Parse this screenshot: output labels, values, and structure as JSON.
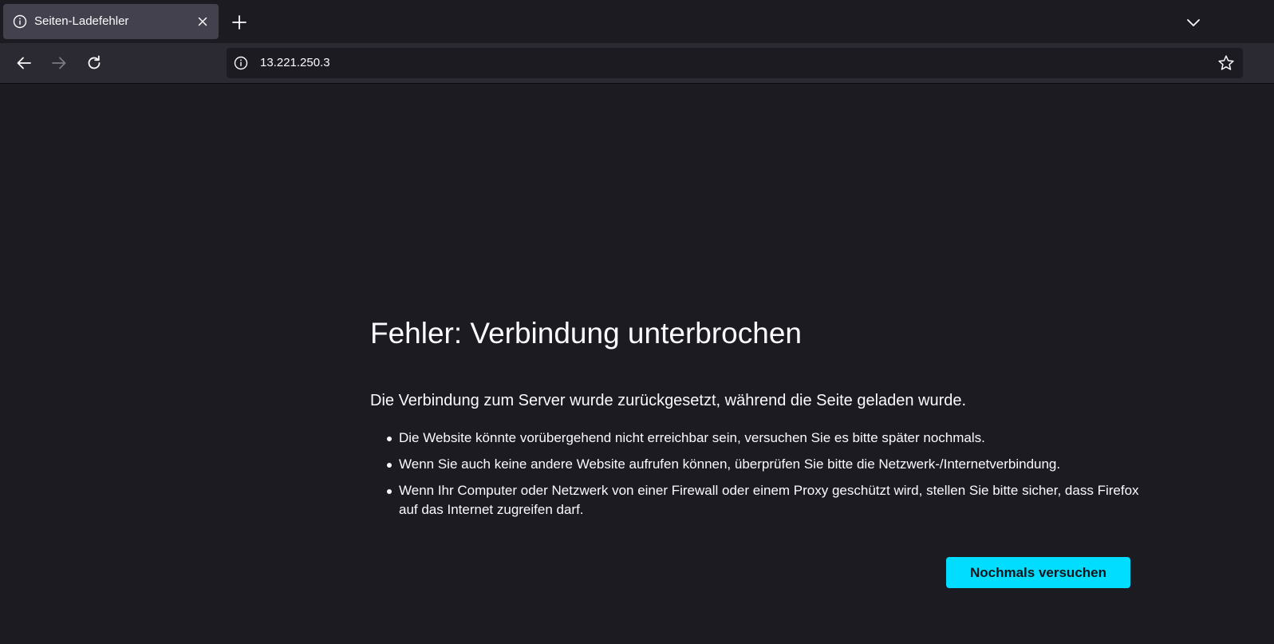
{
  "window": {
    "tab": {
      "title": "Seiten-Ladefehler",
      "icon": "info-icon",
      "close_icon": "close-icon"
    },
    "new_tab_icon": "plus-icon",
    "tab_list_icon": "chevron-down-icon"
  },
  "navbar": {
    "back_icon": "arrow-left-icon",
    "forward_icon": "arrow-right-icon",
    "reload_icon": "reload-icon",
    "url": "13.221.250.3",
    "site_info_icon": "info-icon",
    "bookmark_icon": "star-icon"
  },
  "error": {
    "title": "Fehler: Verbindung unterbrochen",
    "description": "Die Verbindung zum Server wurde zurückgesetzt, während die Seite geladen wurde.",
    "items": [
      "Die Website könnte vorübergehend nicht erreichbar sein, versuchen Sie es bitte später nochmals.",
      "Wenn Sie auch keine andere Website aufrufen können, überprüfen Sie bitte die Netzwerk-/Internetverbindung.",
      "Wenn Ihr Computer oder Netzwerk von einer Firewall oder einem Proxy geschützt wird, stellen Sie bitte sicher, dass Firefox auf das Internet zugreifen darf."
    ],
    "retry_label": "Nochmals versuchen"
  },
  "colors": {
    "background": "#1c1b22",
    "toolbar": "#2b2a33",
    "active_tab": "#42414d",
    "accent_button": "#00ddff",
    "text": "#fbfbfe"
  }
}
